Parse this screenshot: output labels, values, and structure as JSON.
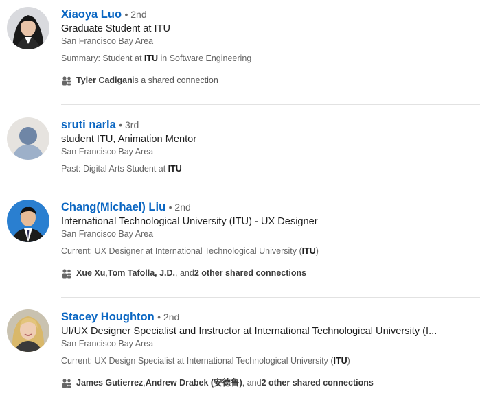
{
  "results": [
    {
      "name": "Xiaoya Luo",
      "degree": "• 2nd",
      "headline": "Graduate Student at ITU",
      "location": "San Francisco Bay Area",
      "snippet_prefix": "Summary: Student at ",
      "snippet_bold": "ITU",
      "snippet_suffix": " in Software Engineering",
      "shared_bold_1": "Tyler Cadigan",
      "shared_rest": " is a shared connection"
    },
    {
      "name": "sruti narla",
      "degree": "• 3rd",
      "headline": "student ITU, Animation Mentor",
      "location": "San Francisco Bay Area",
      "snippet_prefix": "Past: Digital Arts Student at ",
      "snippet_bold": "ITU",
      "snippet_suffix": ""
    },
    {
      "name": "Chang(Michael) Liu",
      "degree": "• 2nd",
      "headline": "International Technological University (ITU) - UX Designer",
      "location": "San Francisco Bay Area",
      "snippet_prefix": "Current: UX Designer at International Technological University (",
      "snippet_bold": "ITU",
      "snippet_suffix": ")",
      "shared_bold_1": "Xue Xu",
      "shared_sep_1": ", ",
      "shared_bold_2": "Tom Tafolla, J.D.",
      "shared_sep_2": ", and ",
      "shared_bold_3": "2 other shared connections"
    },
    {
      "name": "Stacey Houghton",
      "degree": "• 2nd",
      "headline": "UI/UX Designer Specialist and Instructor at International Technological University (I...",
      "location": "San Francisco Bay Area",
      "snippet_prefix": "Current: UX Design Specialist at International Technological University (",
      "snippet_bold": "ITU",
      "snippet_suffix": ")",
      "shared_bold_1": "James Gutierrez",
      "shared_sep_1": ", ",
      "shared_bold_2": "Andrew Drabek (安德鲁)",
      "shared_sep_2": ", and ",
      "shared_bold_3": "2 other shared connections"
    }
  ],
  "icons": {
    "shared_connection": "people-icon"
  },
  "colors": {
    "link": "#0a66c2",
    "secondary_text": "#666666",
    "divider": "#e2e2e2"
  }
}
